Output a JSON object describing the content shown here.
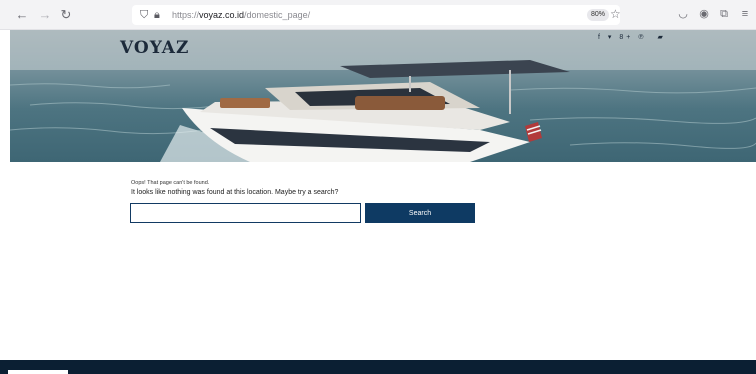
{
  "browser": {
    "url_scheme": "https://",
    "url_host": "voyaz.co.id",
    "url_path": "/domestic_page/",
    "zoom": "80%",
    "icons": [
      "back-icon",
      "forward-icon",
      "reload-icon",
      "shield-icon",
      "lock-icon",
      "star-icon",
      "pocket-icon",
      "account-icon",
      "extensions-icon",
      "menu-icon"
    ]
  },
  "site": {
    "logo": "VOYAZ",
    "social_icons": [
      "facebook-icon",
      "twitter-icon",
      "google-plus-icon",
      "pinterest-icon",
      "cart-icon"
    ]
  },
  "not_found": {
    "title": "Oops! That page can't be found.",
    "message": "It looks like nothing was found at this location. Maybe try a search?",
    "search_value": "",
    "search_button": "Search"
  },
  "colors": {
    "accent": "#0e3a63",
    "footer": "#0b1f33"
  }
}
